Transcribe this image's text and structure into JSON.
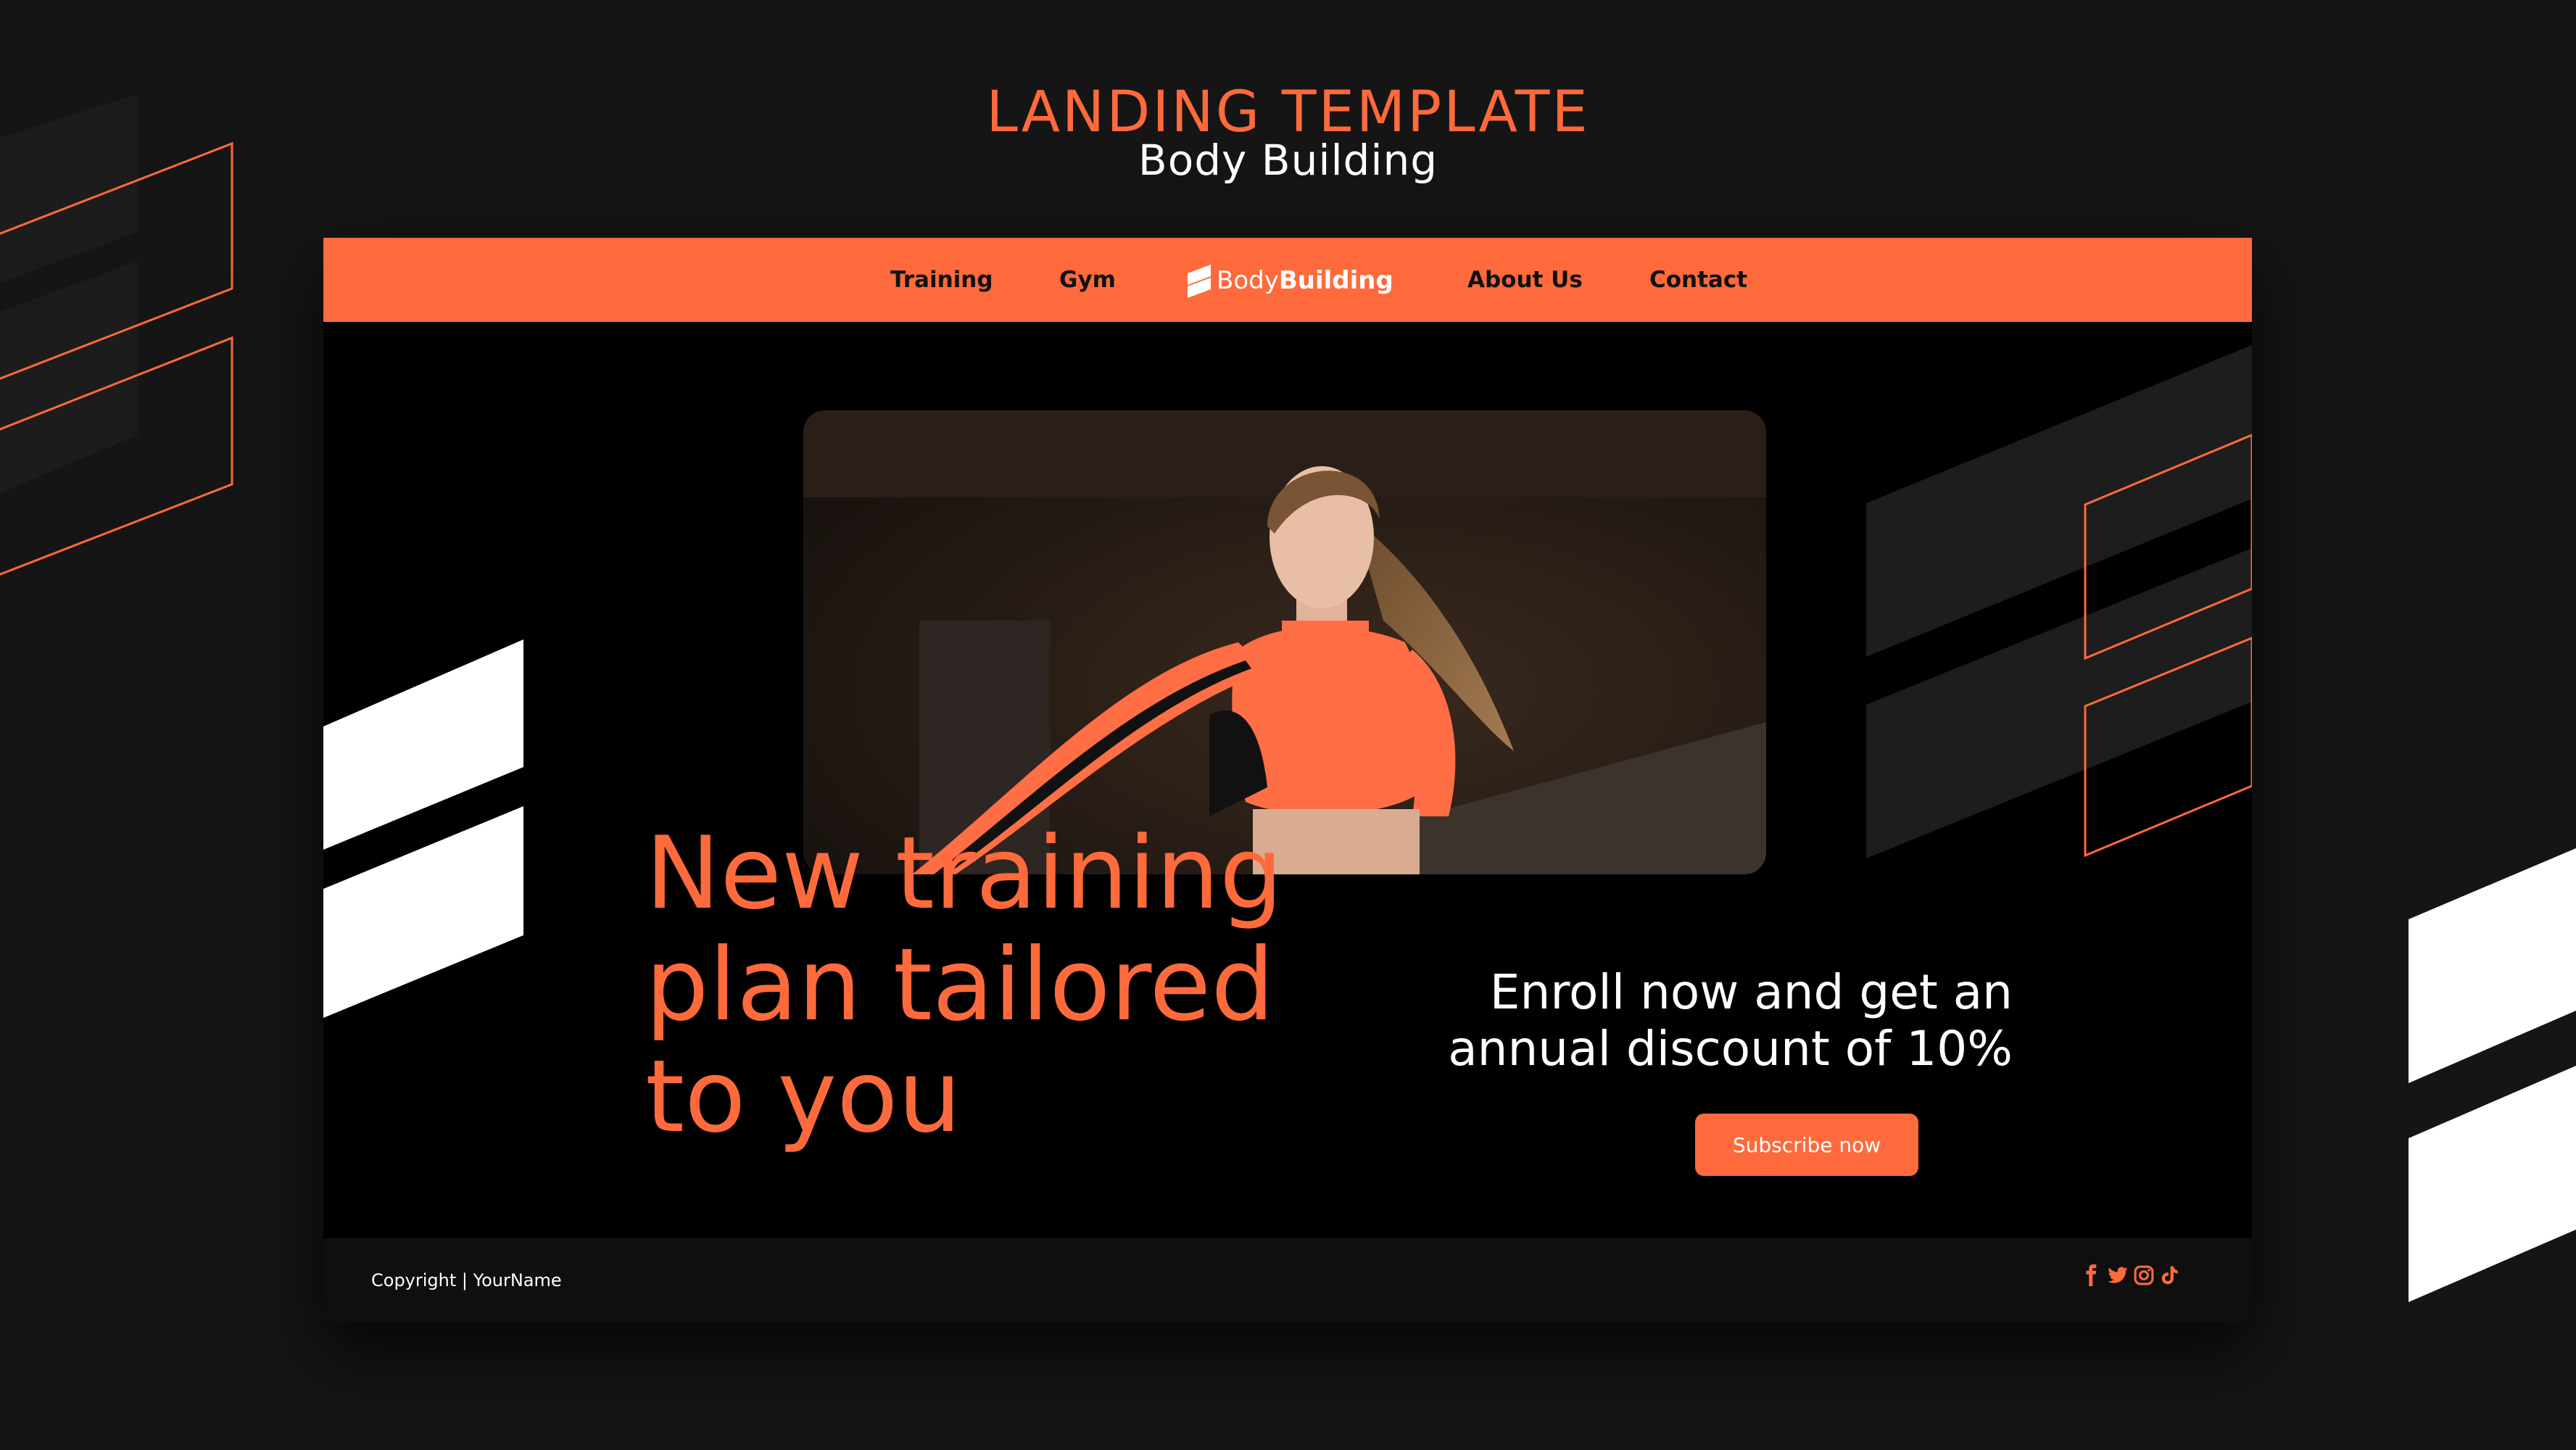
{
  "header": {
    "title": "LANDING TEMPLATE",
    "subtitle": "Body Building"
  },
  "navbar": {
    "items": [
      "Training",
      "Gym",
      "About Us",
      "Contact"
    ],
    "logo_light": "Body",
    "logo_bold": "Building"
  },
  "hero": {
    "headline_lines": [
      "New training",
      "plan tailored",
      "to you"
    ],
    "enroll_lines": [
      "Enroll now and get an",
      "annual discount of 10%"
    ],
    "cta_label": "Subscribe now"
  },
  "footer": {
    "copyright": "Copyright | YourName",
    "social_icons": [
      "facebook-icon",
      "twitter-icon",
      "instagram-icon",
      "tiktok-icon"
    ]
  },
  "colors": {
    "accent": "#ff6a3c",
    "background": "#151515",
    "panel": "#000000",
    "text_light": "#ffffff"
  }
}
